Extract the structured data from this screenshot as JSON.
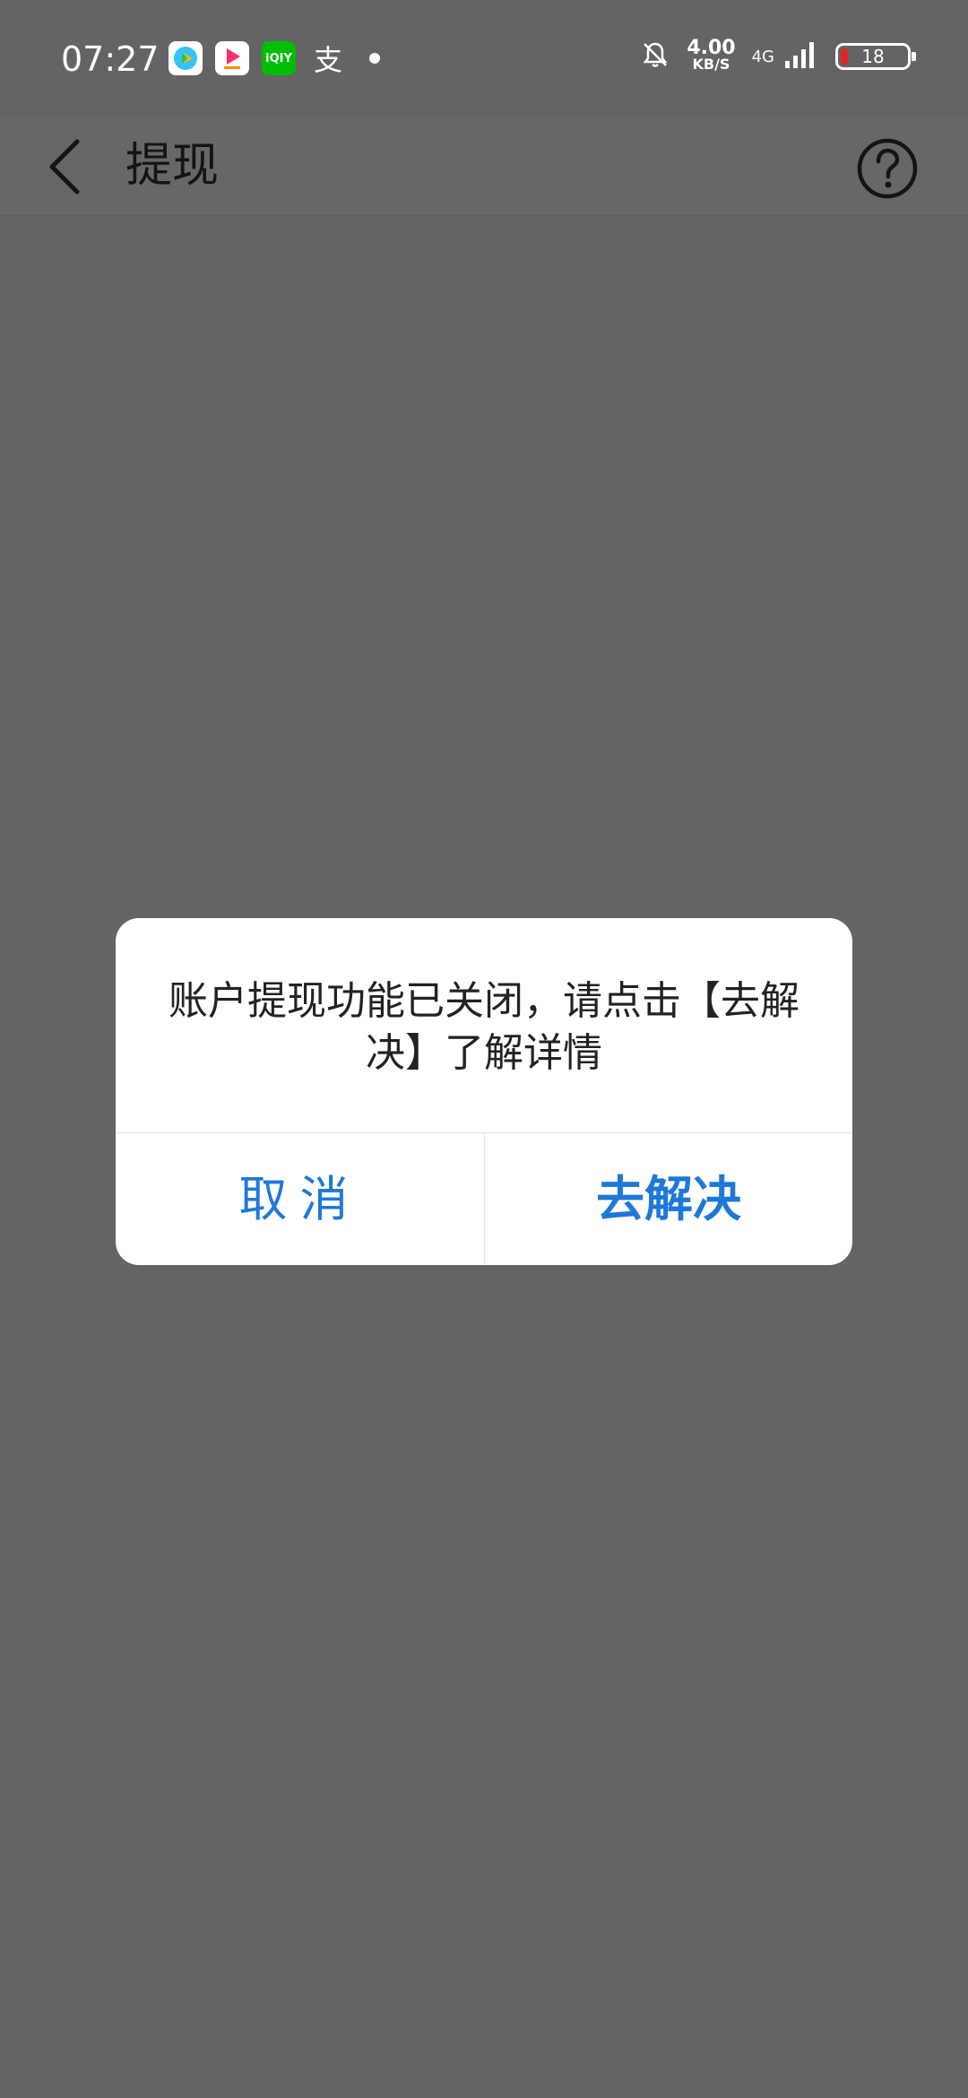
{
  "status_bar": {
    "time": "07:27",
    "net_speed_value": "4.00",
    "net_speed_unit": "KB/S",
    "network_type": "4G",
    "battery_level": "18",
    "notification_icons": [
      "video-app-icon",
      "mango-tv-icon",
      "iqiyi-icon",
      "alipay-icon"
    ],
    "iqiyi_label": "iQIY",
    "alipay_glyph": "支"
  },
  "header": {
    "title": "提现",
    "back_icon": "chevron-left-icon",
    "help_icon": "question-circle-icon"
  },
  "dialog": {
    "message": "账户提现功能已关闭，请点击【去解决】了解详情",
    "cancel_label": "取消",
    "resolve_label": "去解决"
  },
  "colors": {
    "overlay": "#646464",
    "dialog_background": "#ffffff",
    "accent": "#1e78d8",
    "text": "#222222",
    "battery_low": "#e02424"
  }
}
